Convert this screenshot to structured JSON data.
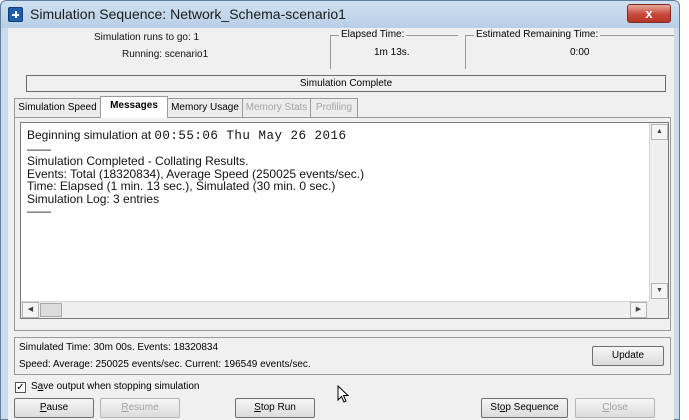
{
  "window": {
    "title": "Simulation Sequence: Network_Schema-scenario1",
    "close_label": "x"
  },
  "info": {
    "runs_to_go_label": "Simulation runs to go:  1",
    "running_label": "Running:  scenario1",
    "elapsed_title": "Elapsed Time:",
    "elapsed_value": "1m 13s.",
    "remaining_title": "Estimated Remaining Time:",
    "remaining_value": "0:00"
  },
  "status": "Simulation Complete",
  "tabs": [
    {
      "label": "Simulation Speed",
      "state": "normal"
    },
    {
      "label": "Messages",
      "state": "active"
    },
    {
      "label": "Memory Usage",
      "state": "normal"
    },
    {
      "label": "Memory Stats",
      "state": "disabled"
    },
    {
      "label": "Profiling",
      "state": "disabled"
    }
  ],
  "log": {
    "begin_prefix": "Beginning simulation at ",
    "begin_time": "00:55:06 Thu May 26 2016",
    "sep1": "——",
    "completed": "Simulation Completed - Collating Results.",
    "events": "Events: Total (18320834), Average Speed (250025 events/sec.)",
    "time": "Time: Elapsed (1 min. 13 sec.), Simulated (30 min. 0 sec.)",
    "log_entries": "Simulation Log: 3 entries",
    "sep2": "——"
  },
  "stats": {
    "line1": "Simulated Time:  30m 00s.   Events:  18320834",
    "line2": "Speed:  Average:  250025  events/sec.  Current:   196549  events/sec.",
    "update_label": "Update"
  },
  "options": {
    "save_output_checked": true,
    "save_output_label": "Save output when stopping simulation"
  },
  "buttons": {
    "pause": "Pause",
    "resume": "Resume",
    "stop_run": "Stop Run",
    "stop_sequence": "Stop Sequence",
    "close": "Close"
  }
}
